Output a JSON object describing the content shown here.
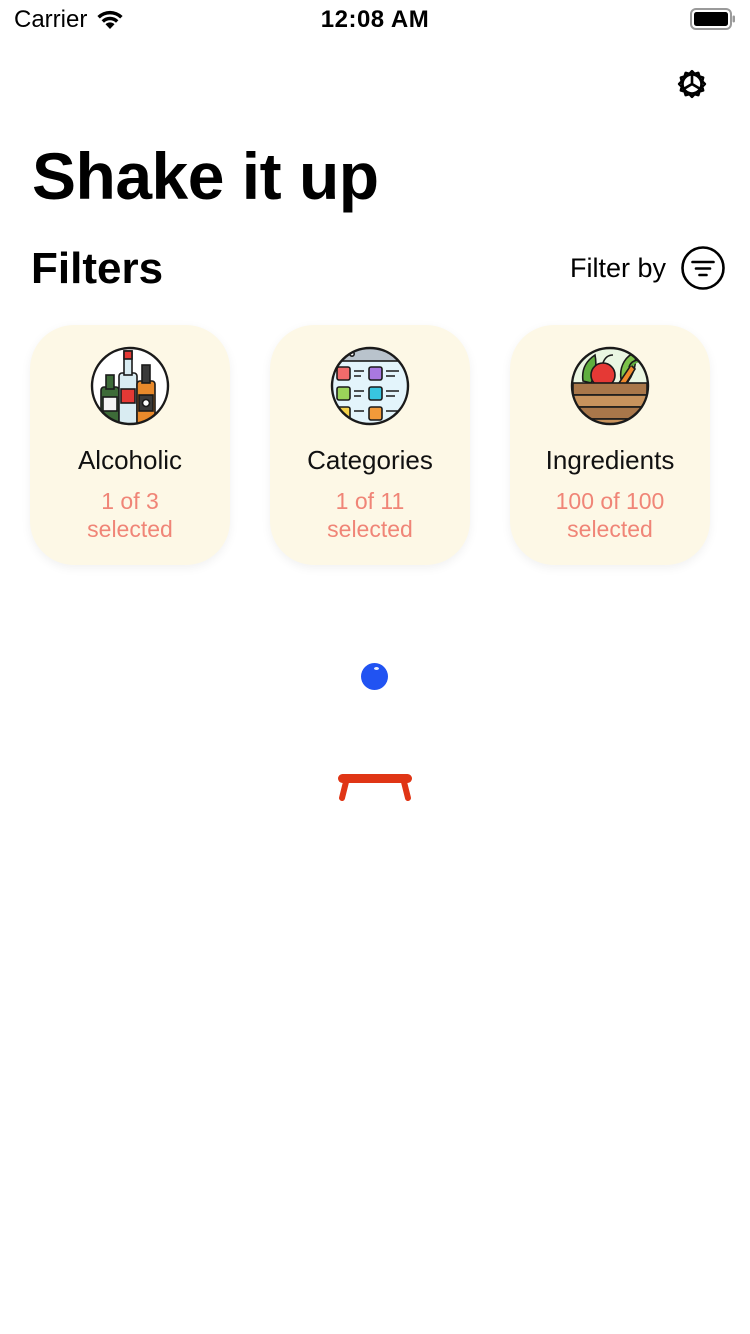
{
  "status_bar": {
    "carrier": "Carrier",
    "time": "12:08 AM"
  },
  "header": {
    "settings_icon": "gear-icon",
    "title": "Shake it up"
  },
  "filters": {
    "title": "Filters",
    "filter_by_label": "Filter by",
    "filter_icon": "filter-lines-icon",
    "cards": [
      {
        "label": "Alcoholic",
        "count": "1 of 3",
        "suffix": "selected",
        "icon": "liquor-bottles-icon"
      },
      {
        "label": "Categories",
        "count": "1 of 11",
        "suffix": "selected",
        "icon": "category-grid-icon"
      },
      {
        "label": "Ingredients",
        "count": "100 of 100",
        "suffix": "selected",
        "icon": "vegetable-crate-icon"
      }
    ]
  },
  "colors": {
    "card_background": "#fdf8e6",
    "count_text": "#f08577",
    "ball": "#2153f2",
    "paddle": "#e03515"
  }
}
